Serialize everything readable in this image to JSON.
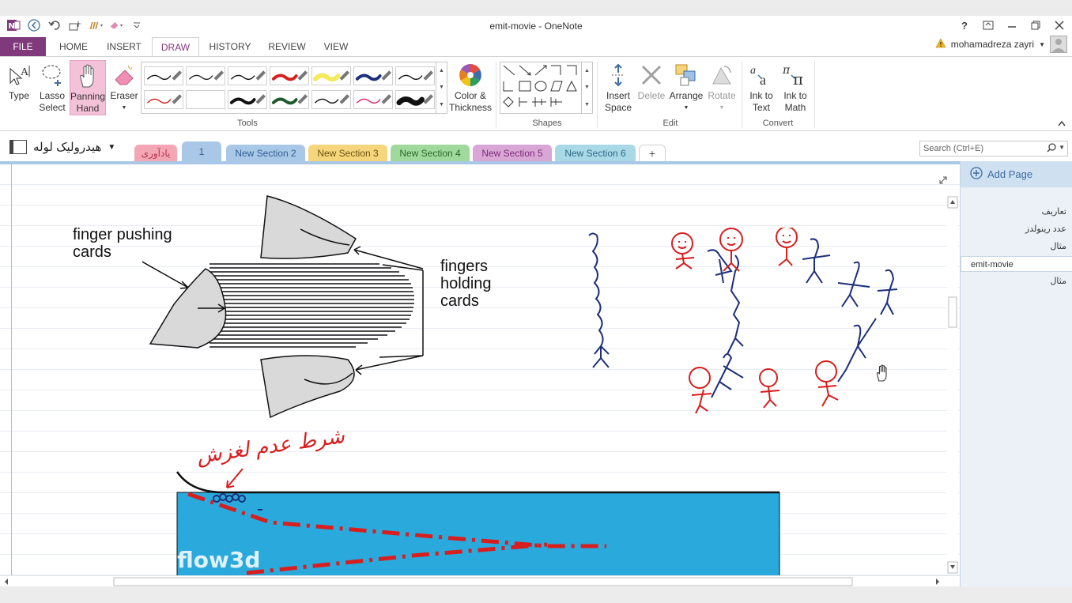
{
  "app": {
    "title": "emit-movie - OneNote",
    "help": "?",
    "user": "mohamadreza zayri"
  },
  "ribbon_tabs": [
    {
      "label": "FILE"
    },
    {
      "label": "HOME"
    },
    {
      "label": "INSERT"
    },
    {
      "label": "DRAW"
    },
    {
      "label": "HISTORY"
    },
    {
      "label": "REVIEW"
    },
    {
      "label": "VIEW"
    }
  ],
  "ribbon": {
    "type": "Type",
    "lasso": "Lasso\nSelect",
    "panning": "Panning\nHand",
    "eraser": "Eraser",
    "color_thickness": "Color &\nThickness",
    "tools_group": "Tools",
    "shapes_group": "Shapes",
    "insert_space": "Insert\nSpace",
    "delete": "Delete",
    "arrange": "Arrange",
    "rotate": "Rotate",
    "edit_group": "Edit",
    "ink_to_text": "Ink to\nText",
    "ink_to_math": "Ink to\nMath",
    "convert_group": "Convert"
  },
  "pens": [
    {
      "color": "#111111",
      "style": "thin"
    },
    {
      "color": "#222222",
      "style": "thin"
    },
    {
      "color": "#111111",
      "style": "thin"
    },
    {
      "color": "#d81e1e",
      "style": "thick"
    },
    {
      "color": "#f4ea5c",
      "style": "highlighter"
    },
    {
      "color": "#1d2f7a",
      "style": "thick"
    },
    {
      "color": "#111111",
      "style": "thin"
    },
    {
      "color": "#d81e1e",
      "style": "thin"
    },
    {
      "color": "#ffffff",
      "style": "blank"
    },
    {
      "color": "#111111",
      "style": "thick"
    },
    {
      "color": "#1f5a2b",
      "style": "thick"
    },
    {
      "color": "#111111",
      "style": "thin"
    },
    {
      "color": "#e0245e",
      "style": "thin"
    },
    {
      "color": "#111111",
      "style": "marker"
    }
  ],
  "notebook": {
    "name": "هیدرولیک لوله"
  },
  "sections": [
    {
      "label": "یادآوری",
      "color": "#f4a6b4"
    },
    {
      "label": "1",
      "color": "#a9c7e6"
    },
    {
      "label": "New Section 2",
      "color": "#a9c7e6"
    },
    {
      "label": "New Section 3",
      "color": "#f6d67c"
    },
    {
      "label": "New Section 4",
      "color": "#9fd99c"
    },
    {
      "label": "New Section 5",
      "color": "#d9a6d6"
    },
    {
      "label": "New Section 6",
      "color": "#a9d8e6"
    },
    {
      "label": "+",
      "color": "#ffffff"
    }
  ],
  "search": {
    "placeholder": "Search (Ctrl+E)"
  },
  "pages": {
    "add_label": "Add Page",
    "items": [
      {
        "label": "تعاریف"
      },
      {
        "label": "عدد رینولدز"
      },
      {
        "label": "مثال"
      },
      {
        "label": "emit-movie"
      },
      {
        "label": "مثال"
      }
    ]
  },
  "content": {
    "label_finger_pushing": "finger pushing\ncards",
    "label_fingers_holding": "fingers\nholding\ncards",
    "handwriting_persian": "شرط عدم لغزش",
    "watermark": "flow3d"
  }
}
